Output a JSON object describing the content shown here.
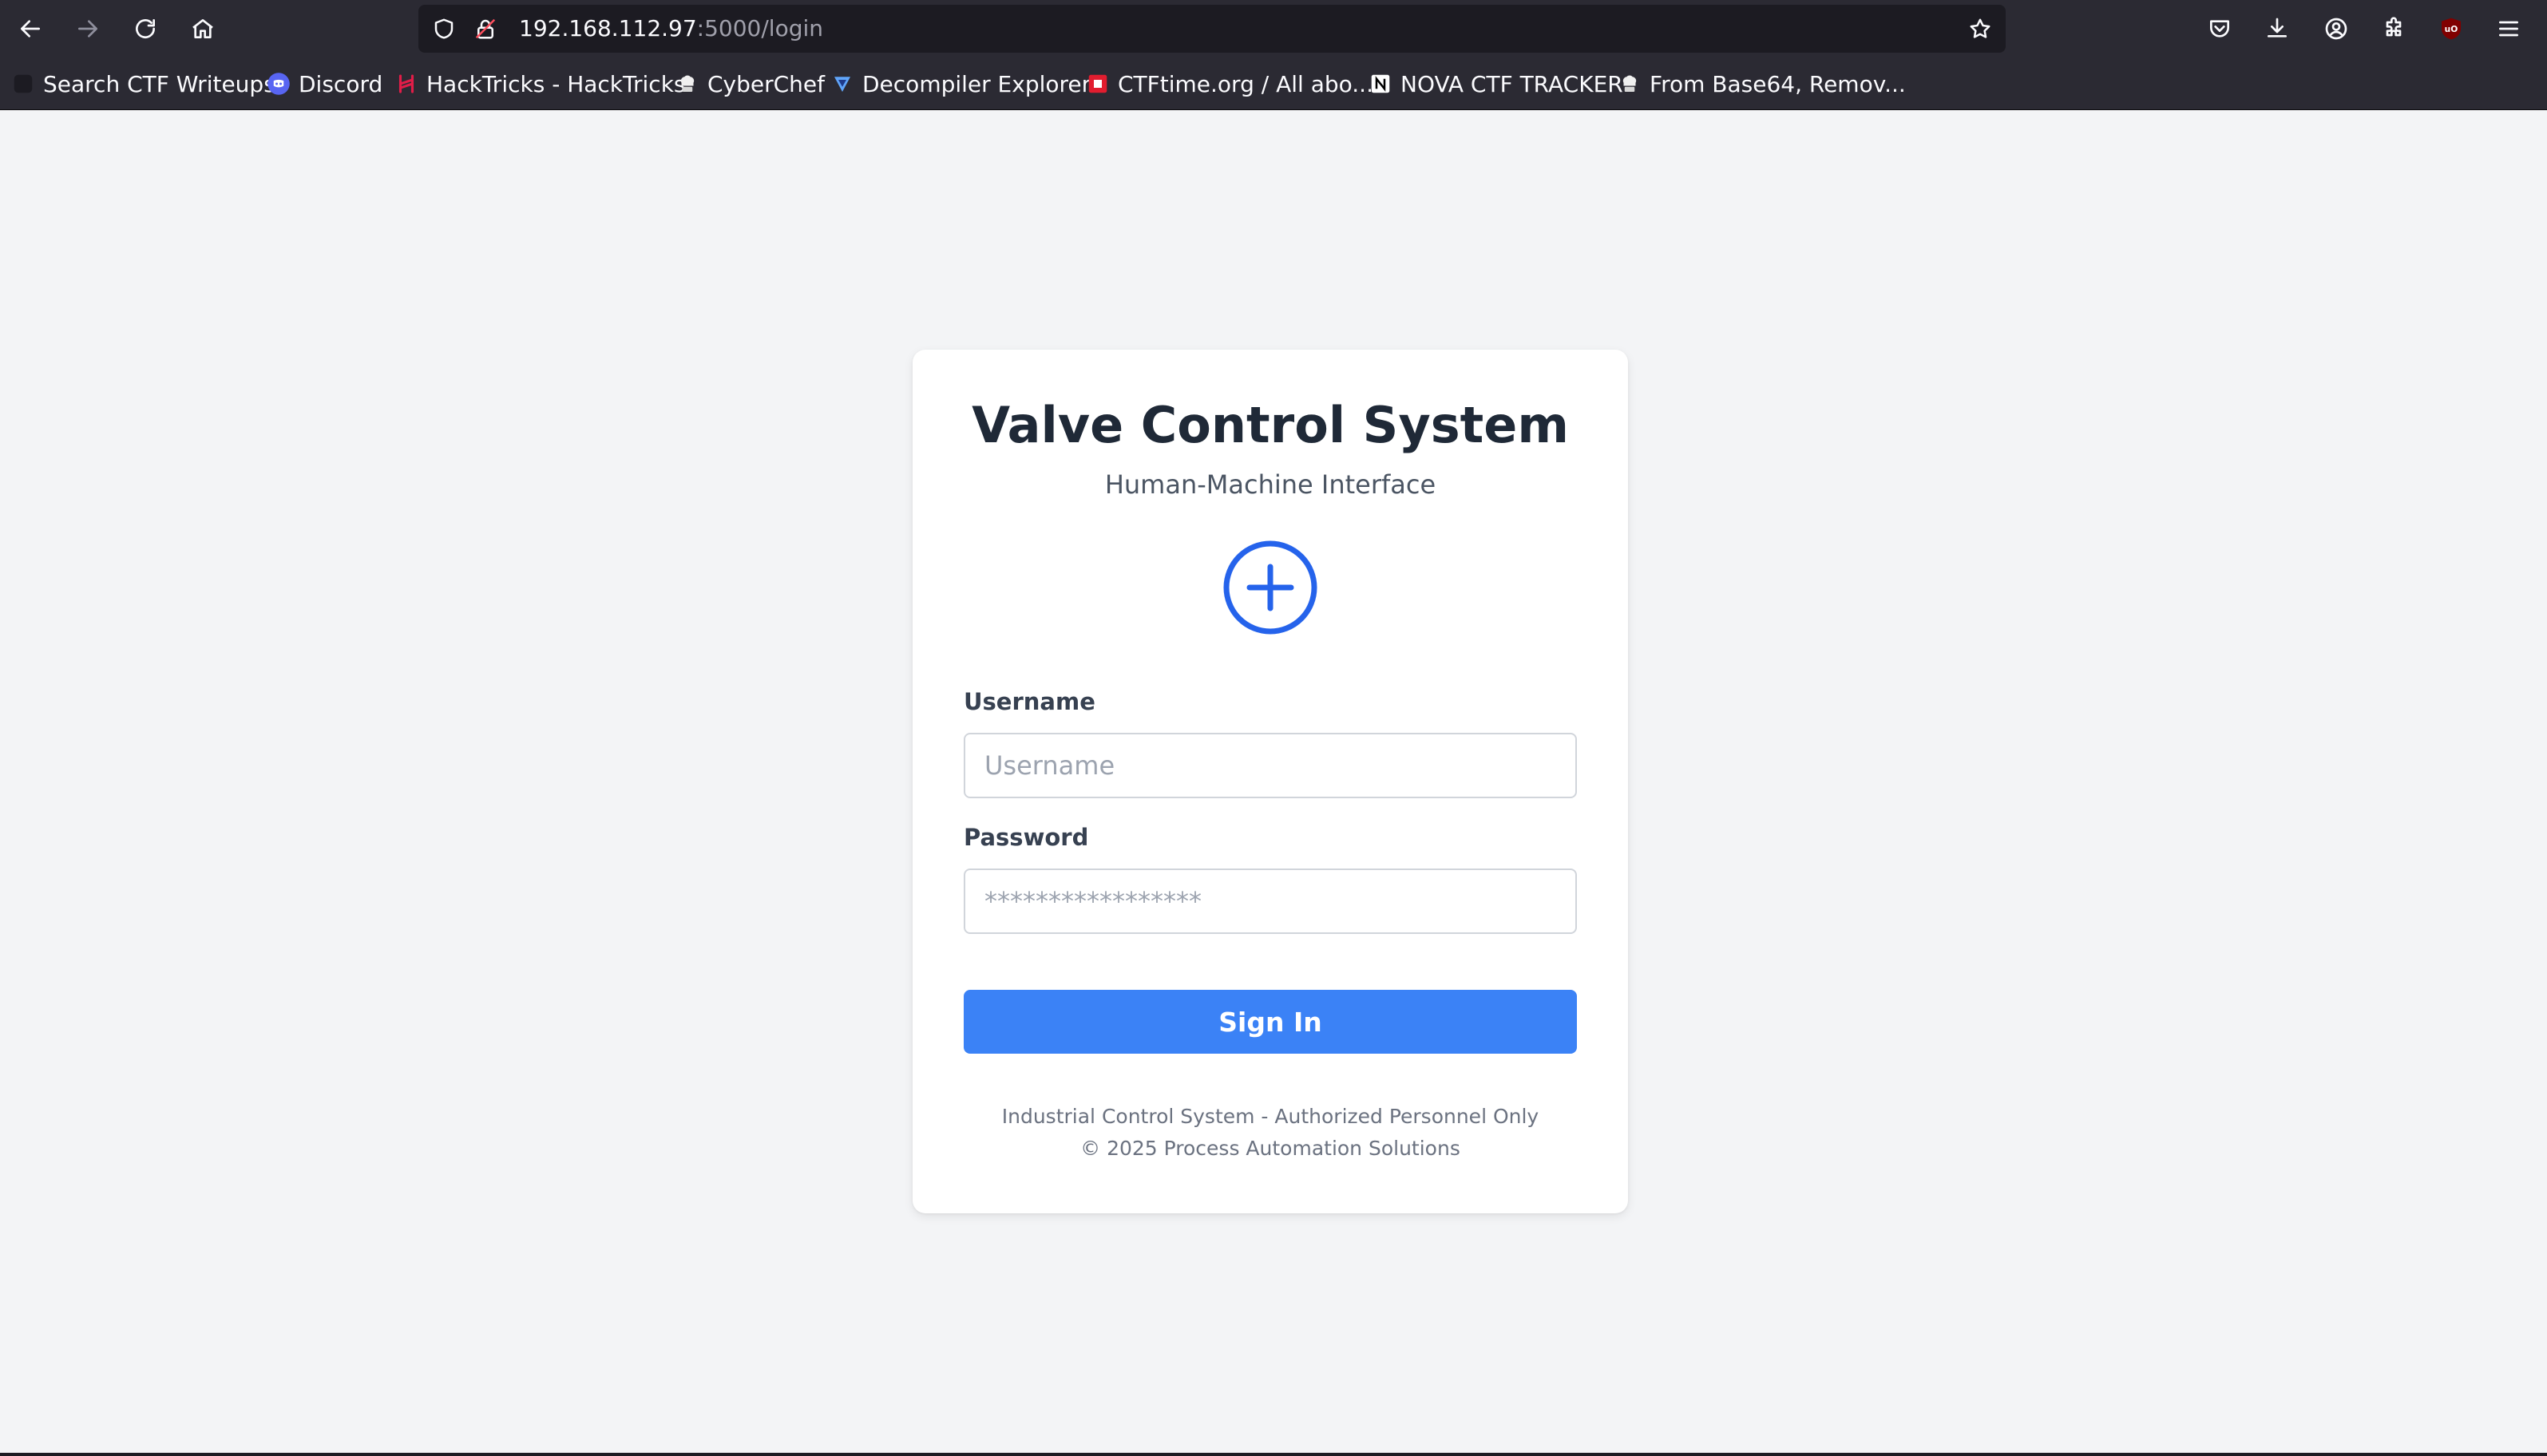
{
  "browser": {
    "url_host": "192.168.112.97",
    "url_path": ":5000/login",
    "bookmarks": [
      {
        "label": "Search CTF Writeups",
        "icon": "ctf-writeups-icon"
      },
      {
        "label": "Discord",
        "icon": "discord-icon"
      },
      {
        "label": "HackTricks - HackTricks",
        "icon": "hacktricks-icon"
      },
      {
        "label": "CyberChef",
        "icon": "cyberchef-icon"
      },
      {
        "label": "Decompiler Explorer",
        "icon": "decompiler-icon"
      },
      {
        "label": "CTFtime.org / All abo...",
        "icon": "ctftime-icon"
      },
      {
        "label": "NOVA CTF TRACKER",
        "icon": "notion-icon"
      },
      {
        "label": "From Base64, Remov...",
        "icon": "cyberchef-icon"
      }
    ]
  },
  "login": {
    "title": "Valve Control System",
    "subtitle": "Human-Machine Interface",
    "username_label": "Username",
    "username_placeholder": "Username",
    "password_label": "Password",
    "password_placeholder": "*****************",
    "signin_label": "Sign In",
    "footer_line1": "Industrial Control System - Authorized Personnel Only",
    "footer_line2": "© 2025 Process Automation Solutions"
  },
  "colors": {
    "accent": "#3b82f6",
    "logo": "#2563eb",
    "page_bg": "#f3f4f6",
    "chrome_bg": "#2b2a33"
  }
}
